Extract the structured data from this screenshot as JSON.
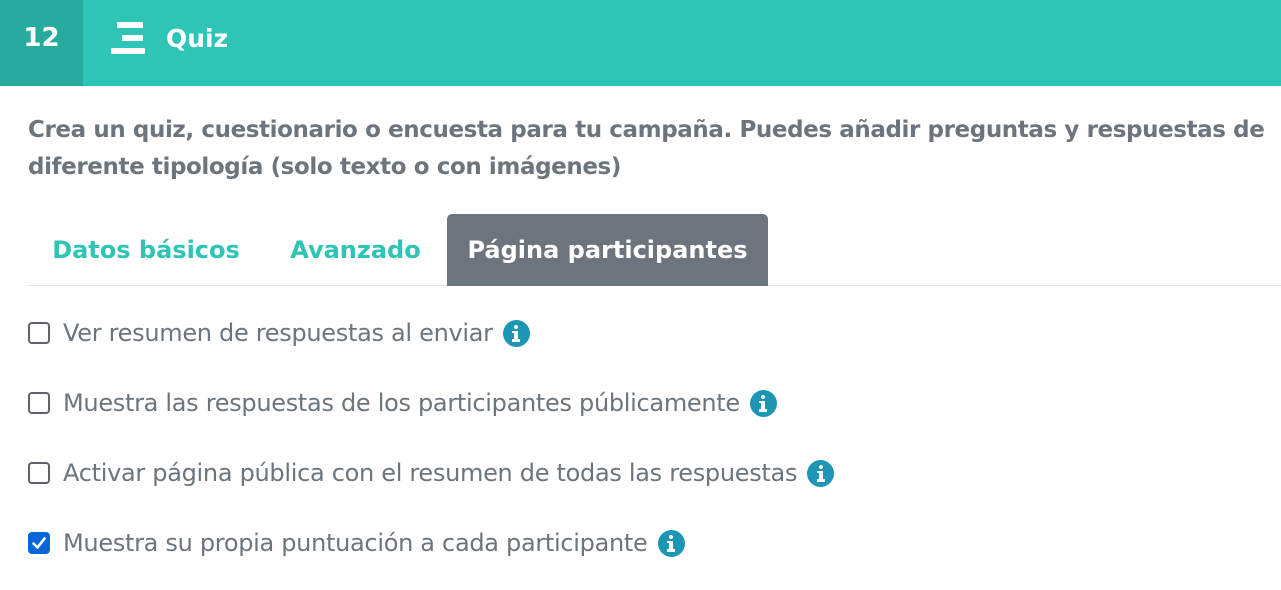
{
  "header": {
    "step_number": "12",
    "title": "Quiz",
    "icon": "menu-icon",
    "background_color": "#2ec4b6",
    "step_background_color": "#27ab9f"
  },
  "description": "Crea un quiz, cuestionario o encuesta para tu campaña. Puedes añadir preguntas y respuestas de diferente tipología (solo texto o con imágenes)",
  "tabs": [
    {
      "label": "Datos básicos",
      "active": false
    },
    {
      "label": "Avanzado",
      "active": false
    },
    {
      "label": "Página participantes",
      "active": true
    }
  ],
  "options": [
    {
      "label": "Ver resumen de respuestas al enviar",
      "checked": false,
      "icon": "info-icon"
    },
    {
      "label": "Muestra las respuestas de los participantes públicamente",
      "checked": false,
      "icon": "info-icon"
    },
    {
      "label": "Activar página pública con el resumen de todas las respuestas",
      "checked": false,
      "icon": "info-icon"
    },
    {
      "label": "Muestra su propia puntuación a cada participante",
      "checked": true,
      "icon": "info-icon"
    }
  ],
  "colors": {
    "accent": "#2ec4b6",
    "active_tab": "#6c757d",
    "text_muted": "#6c757d",
    "info": "#1c96b4",
    "checkbox_checked": "#0a66d6"
  }
}
